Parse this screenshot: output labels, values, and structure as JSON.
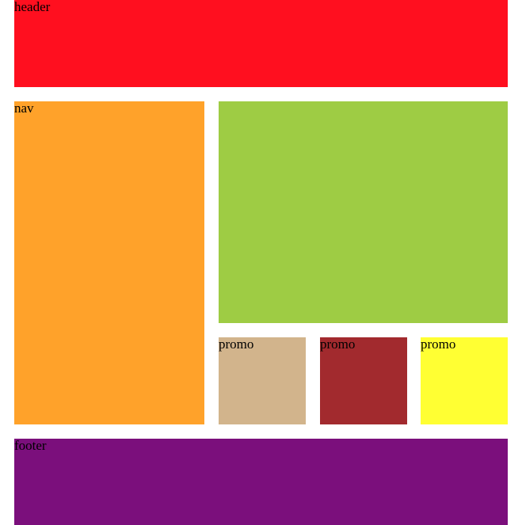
{
  "header": {
    "label": "header",
    "color": "#ff0f1f"
  },
  "nav": {
    "label": "nav",
    "color": "#ffa22a"
  },
  "main": {
    "label": "",
    "color": "#9ecc44"
  },
  "promos": [
    {
      "label": "promo",
      "color": "#d2b48c"
    },
    {
      "label": "promo",
      "color": "#a22a2e"
    },
    {
      "label": "promo",
      "color": "#ffff33"
    }
  ],
  "footer": {
    "label": "footer",
    "color": "#7b0f7c"
  }
}
